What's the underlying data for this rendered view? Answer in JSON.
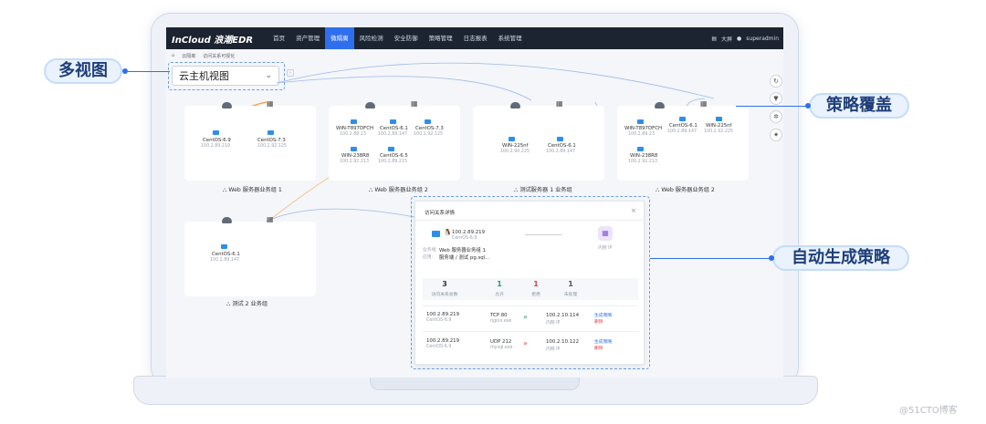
{
  "callouts": {
    "view": "多视图",
    "policy_override": "策略覆盖",
    "auto_policy": "自动生成策略"
  },
  "watermark": "@51CTO博客",
  "nav": {
    "logo": "InCloud 浪潮EDR",
    "items": [
      "首页",
      "资产管理",
      "微隔离",
      "风险检测",
      "安全防御",
      "策略管理",
      "日志报表",
      "系统管理"
    ],
    "active_index": 2,
    "right_icon": "layout-icon",
    "right_label": "大屏",
    "user": "superadmin"
  },
  "breadcrumb": [
    "云隔离",
    "访问关系可视化"
  ],
  "view_select": {
    "value": "云主机视图"
  },
  "groups": [
    {
      "label": "Web 服务器业务组 1",
      "hosts": [
        {
          "name": "CentOS-6.9",
          "ip": "100.2.89.219"
        },
        {
          "name": "CentOS-7.3",
          "ip": "100.2.92.125"
        }
      ]
    },
    {
      "label": "Web 服务器业务组 2",
      "hosts": [
        {
          "name": "WIN-T897DFCH",
          "ip": "100.2.89.23"
        },
        {
          "name": "CentOS-6.1",
          "ip": "100.2.89.147"
        },
        {
          "name": "CentOS-7.3",
          "ip": "100.2.92.125"
        },
        {
          "name": "WIN-238R8",
          "ip": "100.2.92.213"
        },
        {
          "name": "CentOS-6.5",
          "ip": "100.2.89.215"
        }
      ]
    },
    {
      "label": "测试服务器 1 业务组",
      "hosts": [
        {
          "name": "WIN-225nf",
          "ip": "100.2.90.225"
        },
        {
          "name": "CentOS-6.1",
          "ip": "100.2.89.147"
        }
      ]
    },
    {
      "label": "Web 服务器业务组 2",
      "hosts": [
        {
          "name": "WIN-T897DFCH",
          "ip": "100.2.89.23"
        },
        {
          "name": "CentOS-6.1",
          "ip": "100.2.89.147"
        },
        {
          "name": "WIN-225nf",
          "ip": "100.2.92.225"
        },
        {
          "name": "WIN-238R8",
          "ip": "100.2.92.213"
        }
      ]
    },
    {
      "label": "测试 2 业务组",
      "hosts": [
        {
          "name": "CentOS-6.1",
          "ip": "100.2.89.147"
        }
      ]
    }
  ],
  "panel": {
    "title": "访问关系详情",
    "source_ip": "100.2.89.219",
    "source_os": "CentOS-6.9",
    "group_label": "业务组:",
    "group_value": "Web 服务器业务组 1",
    "process_label": "应用:",
    "process_value": "服务端 / 测试 pg.sql...",
    "target": "内网 IP",
    "stats": [
      {
        "value": "3",
        "label": "访问关系总数",
        "color": "#333333"
      },
      {
        "value": "1",
        "label": "允许",
        "color": "#22a06b"
      },
      {
        "value": "1",
        "label": "拒绝",
        "color": "#e04545"
      },
      {
        "value": "1",
        "label": "未处理",
        "color": "#555555"
      }
    ],
    "rows": [
      {
        "src_ip": "100.2.89.219",
        "src_os": "CentOS-6.9",
        "proto": "TCP 80",
        "proc": "nginx.exe",
        "arrow_color": "#22a06b",
        "dst_ip": "100.2.10.114",
        "dst_name": "内网 IP",
        "action1": "生成策略",
        "action2": "删除"
      },
      {
        "src_ip": "100.2.89.219",
        "src_os": "CentOS-6.9",
        "proto": "UDP 212",
        "proc": "mysql.exe",
        "arrow_color": "#e04545",
        "dst_ip": "100.2.10.122",
        "dst_name": "内网 IP",
        "action1": "生成策略",
        "action2": "删除"
      }
    ]
  },
  "tools": [
    "refresh-icon",
    "filter-icon",
    "settings-icon",
    "gear-icon"
  ]
}
